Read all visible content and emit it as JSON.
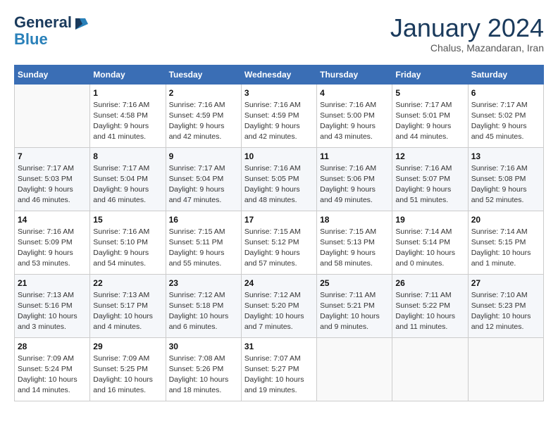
{
  "logo": {
    "line1": "General",
    "line2": "Blue"
  },
  "title": {
    "month": "January 2024",
    "location": "Chalus, Mazandaran, Iran"
  },
  "weekdays": [
    "Sunday",
    "Monday",
    "Tuesday",
    "Wednesday",
    "Thursday",
    "Friday",
    "Saturday"
  ],
  "weeks": [
    [
      {
        "day": null
      },
      {
        "day": 1,
        "sunrise": "7:16 AM",
        "sunset": "4:58 PM",
        "daylight": "9 hours and 41 minutes."
      },
      {
        "day": 2,
        "sunrise": "7:16 AM",
        "sunset": "4:59 PM",
        "daylight": "9 hours and 42 minutes."
      },
      {
        "day": 3,
        "sunrise": "7:16 AM",
        "sunset": "4:59 PM",
        "daylight": "9 hours and 42 minutes."
      },
      {
        "day": 4,
        "sunrise": "7:16 AM",
        "sunset": "5:00 PM",
        "daylight": "9 hours and 43 minutes."
      },
      {
        "day": 5,
        "sunrise": "7:17 AM",
        "sunset": "5:01 PM",
        "daylight": "9 hours and 44 minutes."
      },
      {
        "day": 6,
        "sunrise": "7:17 AM",
        "sunset": "5:02 PM",
        "daylight": "9 hours and 45 minutes."
      }
    ],
    [
      {
        "day": 7,
        "sunrise": "7:17 AM",
        "sunset": "5:03 PM",
        "daylight": "9 hours and 46 minutes."
      },
      {
        "day": 8,
        "sunrise": "7:17 AM",
        "sunset": "5:04 PM",
        "daylight": "9 hours and 46 minutes."
      },
      {
        "day": 9,
        "sunrise": "7:17 AM",
        "sunset": "5:04 PM",
        "daylight": "9 hours and 47 minutes."
      },
      {
        "day": 10,
        "sunrise": "7:16 AM",
        "sunset": "5:05 PM",
        "daylight": "9 hours and 48 minutes."
      },
      {
        "day": 11,
        "sunrise": "7:16 AM",
        "sunset": "5:06 PM",
        "daylight": "9 hours and 49 minutes."
      },
      {
        "day": 12,
        "sunrise": "7:16 AM",
        "sunset": "5:07 PM",
        "daylight": "9 hours and 51 minutes."
      },
      {
        "day": 13,
        "sunrise": "7:16 AM",
        "sunset": "5:08 PM",
        "daylight": "9 hours and 52 minutes."
      }
    ],
    [
      {
        "day": 14,
        "sunrise": "7:16 AM",
        "sunset": "5:09 PM",
        "daylight": "9 hours and 53 minutes."
      },
      {
        "day": 15,
        "sunrise": "7:16 AM",
        "sunset": "5:10 PM",
        "daylight": "9 hours and 54 minutes."
      },
      {
        "day": 16,
        "sunrise": "7:15 AM",
        "sunset": "5:11 PM",
        "daylight": "9 hours and 55 minutes."
      },
      {
        "day": 17,
        "sunrise": "7:15 AM",
        "sunset": "5:12 PM",
        "daylight": "9 hours and 57 minutes."
      },
      {
        "day": 18,
        "sunrise": "7:15 AM",
        "sunset": "5:13 PM",
        "daylight": "9 hours and 58 minutes."
      },
      {
        "day": 19,
        "sunrise": "7:14 AM",
        "sunset": "5:14 PM",
        "daylight": "10 hours and 0 minutes."
      },
      {
        "day": 20,
        "sunrise": "7:14 AM",
        "sunset": "5:15 PM",
        "daylight": "10 hours and 1 minute."
      }
    ],
    [
      {
        "day": 21,
        "sunrise": "7:13 AM",
        "sunset": "5:16 PM",
        "daylight": "10 hours and 3 minutes."
      },
      {
        "day": 22,
        "sunrise": "7:13 AM",
        "sunset": "5:17 PM",
        "daylight": "10 hours and 4 minutes."
      },
      {
        "day": 23,
        "sunrise": "7:12 AM",
        "sunset": "5:18 PM",
        "daylight": "10 hours and 6 minutes."
      },
      {
        "day": 24,
        "sunrise": "7:12 AM",
        "sunset": "5:20 PM",
        "daylight": "10 hours and 7 minutes."
      },
      {
        "day": 25,
        "sunrise": "7:11 AM",
        "sunset": "5:21 PM",
        "daylight": "10 hours and 9 minutes."
      },
      {
        "day": 26,
        "sunrise": "7:11 AM",
        "sunset": "5:22 PM",
        "daylight": "10 hours and 11 minutes."
      },
      {
        "day": 27,
        "sunrise": "7:10 AM",
        "sunset": "5:23 PM",
        "daylight": "10 hours and 12 minutes."
      }
    ],
    [
      {
        "day": 28,
        "sunrise": "7:09 AM",
        "sunset": "5:24 PM",
        "daylight": "10 hours and 14 minutes."
      },
      {
        "day": 29,
        "sunrise": "7:09 AM",
        "sunset": "5:25 PM",
        "daylight": "10 hours and 16 minutes."
      },
      {
        "day": 30,
        "sunrise": "7:08 AM",
        "sunset": "5:26 PM",
        "daylight": "10 hours and 18 minutes."
      },
      {
        "day": 31,
        "sunrise": "7:07 AM",
        "sunset": "5:27 PM",
        "daylight": "10 hours and 19 minutes."
      },
      {
        "day": null
      },
      {
        "day": null
      },
      {
        "day": null
      }
    ]
  ]
}
